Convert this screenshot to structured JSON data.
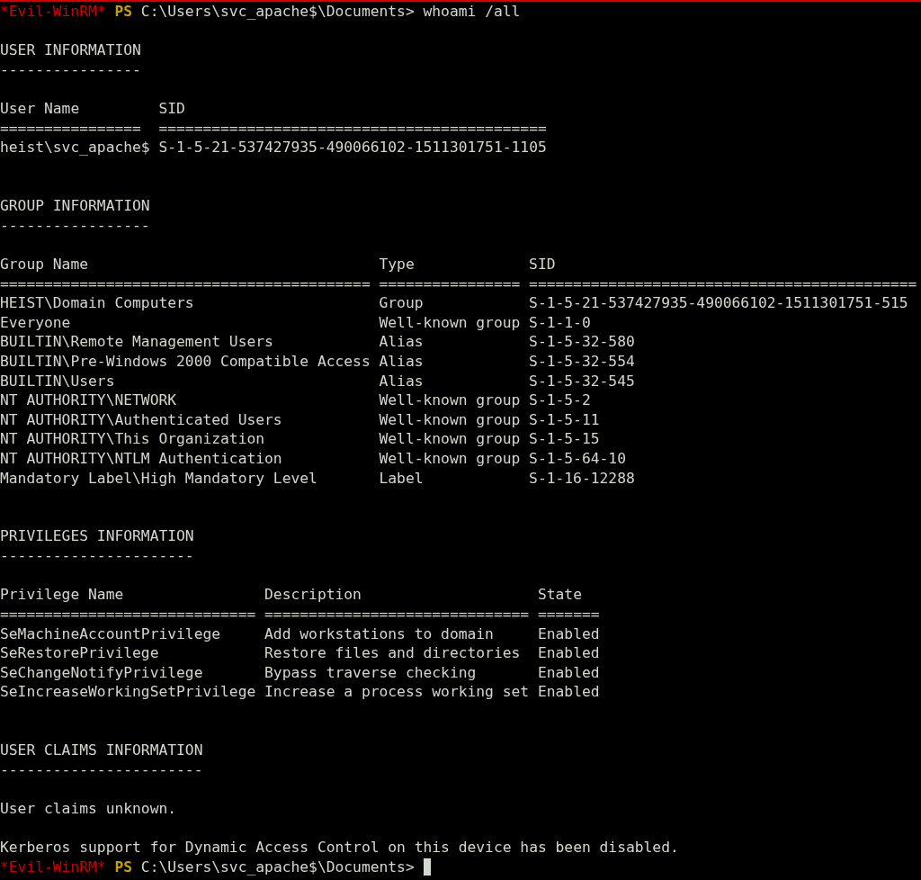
{
  "prompt_top": {
    "shell": "*Evil-WinRM*",
    "ps": "PS",
    "path": "C:\\Users\\svc_apache$\\Documents>",
    "command": "whoami /all"
  },
  "sections": [
    {
      "title": "USER INFORMATION",
      "rule": "----------------",
      "table": {
        "columns": [
          {
            "label": "User Name",
            "underline": "================"
          },
          {
            "label": "SID",
            "underline": "============================================"
          }
        ],
        "rows": [
          [
            "heist\\svc_apache$",
            "S-1-5-21-537427935-490066102-1511301751-1105"
          ]
        ]
      }
    },
    {
      "title": "GROUP INFORMATION",
      "rule": "-----------------",
      "table": {
        "columns": [
          {
            "label": "Group Name",
            "underline": "=========================================="
          },
          {
            "label": "Type",
            "underline": "================"
          },
          {
            "label": "SID",
            "underline": "============================================"
          }
        ],
        "rows": [
          [
            "HEIST\\Domain Computers",
            "Group",
            "S-1-5-21-537427935-490066102-1511301751-515"
          ],
          [
            "Everyone",
            "Well-known group",
            "S-1-1-0"
          ],
          [
            "BUILTIN\\Remote Management Users",
            "Alias",
            "S-1-5-32-580"
          ],
          [
            "BUILTIN\\Pre-Windows 2000 Compatible Access",
            "Alias",
            "S-1-5-32-554"
          ],
          [
            "BUILTIN\\Users",
            "Alias",
            "S-1-5-32-545"
          ],
          [
            "NT AUTHORITY\\NETWORK",
            "Well-known group",
            "S-1-5-2"
          ],
          [
            "NT AUTHORITY\\Authenticated Users",
            "Well-known group",
            "S-1-5-11"
          ],
          [
            "NT AUTHORITY\\This Organization",
            "Well-known group",
            "S-1-5-15"
          ],
          [
            "NT AUTHORITY\\NTLM Authentication",
            "Well-known group",
            "S-1-5-64-10"
          ],
          [
            "Mandatory Label\\High Mandatory Level",
            "Label",
            "S-1-16-12288"
          ]
        ]
      }
    },
    {
      "title": "PRIVILEGES INFORMATION",
      "rule": "----------------------",
      "table": {
        "columns": [
          {
            "label": "Privilege Name",
            "underline": "============================="
          },
          {
            "label": "Description",
            "underline": "=============================="
          },
          {
            "label": "State",
            "underline": "======="
          }
        ],
        "rows": [
          [
            "SeMachineAccountPrivilege",
            "Add workstations to domain",
            "Enabled"
          ],
          [
            "SeRestorePrivilege",
            "Restore files and directories",
            "Enabled"
          ],
          [
            "SeChangeNotifyPrivilege",
            "Bypass traverse checking",
            "Enabled"
          ],
          [
            "SeIncreaseWorkingSetPrivilege",
            "Increase a process working set",
            "Enabled"
          ]
        ]
      }
    },
    {
      "title": "USER CLAIMS INFORMATION",
      "rule": "-----------------------",
      "messages": [
        "User claims unknown.",
        "Kerberos support for Dynamic Access Control on this device has been disabled."
      ]
    }
  ],
  "prompt_bottom": {
    "shell": "*Evil-WinRM*",
    "ps": "PS",
    "path": "C:\\Users\\svc_apache$\\Documents>",
    "cursor": true
  }
}
